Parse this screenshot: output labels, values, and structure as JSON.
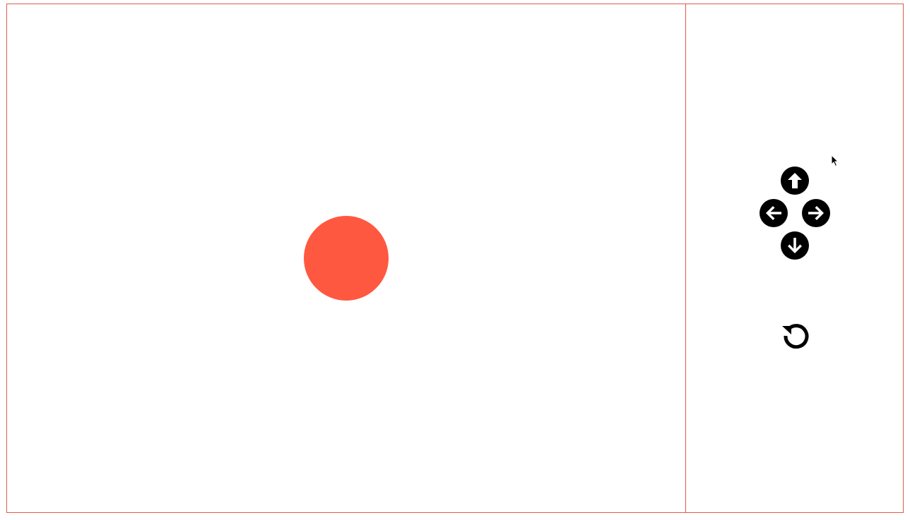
{
  "colors": {
    "border": "#e05a4e",
    "ball": "#ff5840",
    "icon": "#000000"
  },
  "stage": {
    "ball": {
      "shape": "circle"
    }
  },
  "controls": {
    "icons": [
      "arrow-up-icon",
      "arrow-left-icon",
      "arrow-right-icon",
      "arrow-down-icon",
      "reset-icon"
    ]
  }
}
